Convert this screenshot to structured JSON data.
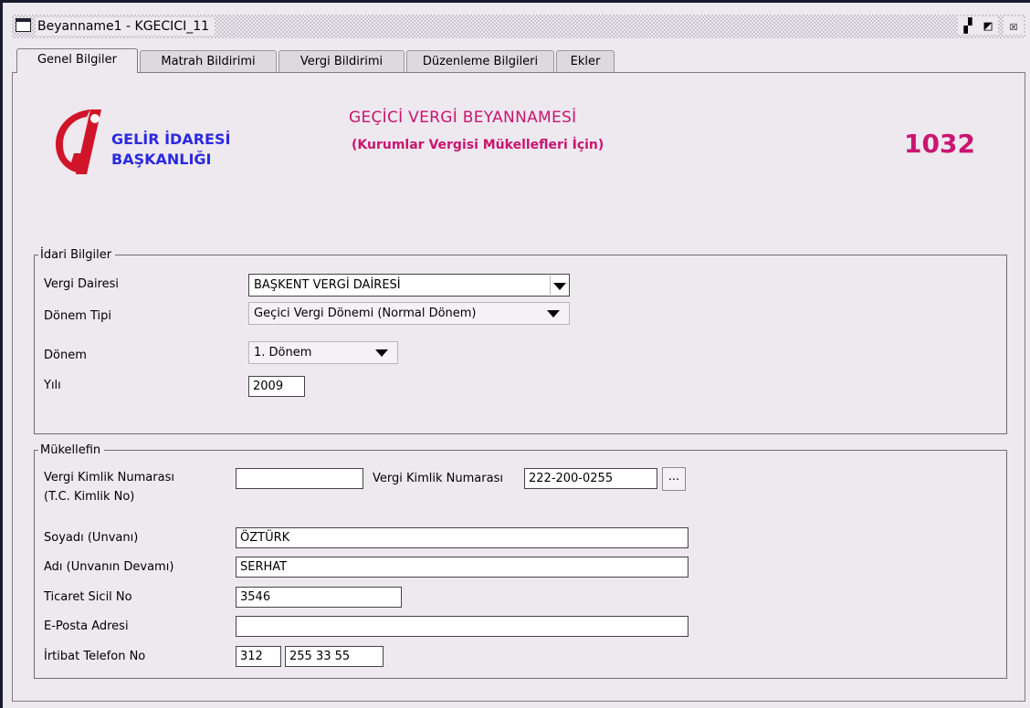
{
  "window": {
    "title": "Beyanname1 - KGECICI_11",
    "buttons": {
      "restore": "▞",
      "maximize": "◩",
      "close": "☒"
    }
  },
  "tabs": [
    {
      "label": "Genel Bilgiler",
      "active": true
    },
    {
      "label": "Matrah Bildirimi",
      "active": false
    },
    {
      "label": "Vergi Bildirimi",
      "active": false
    },
    {
      "label": "Düzenleme Bilgileri",
      "active": false
    },
    {
      "label": "Ekler",
      "active": false
    }
  ],
  "header": {
    "org_line1": "GELİR İDARESİ",
    "org_line2": "BAŞKANLIĞI",
    "form_title": "GEÇİCİ VERGİ BEYANNAMESİ",
    "form_subtitle": "(Kurumlar Vergisi Mükellefleri İçin)",
    "form_code": "1032",
    "colors": {
      "brand_blue": "#2a2ae0",
      "title_magenta": "#c8156f",
      "logo_red": "#d0152a"
    }
  },
  "idari": {
    "legend": "İdari Bilgiler",
    "vergi_dairesi_label": "Vergi Dairesi",
    "vergi_dairesi_value": "BAŞKENT VERGİ DAİRESİ",
    "donem_tipi_label": "Dönem Tipi",
    "donem_tipi_value": "Geçici Vergi Dönemi (Normal Dönem)",
    "donem_label": "Dönem",
    "donem_value": "1. Dönem",
    "yil_label": "Yılı",
    "yil_value": "2009"
  },
  "mukellef": {
    "legend": "Mükellefin",
    "vkn_tc_label_1": "Vergi Kimlik Numarası",
    "vkn_tc_label_2": "(T.C. Kimlik No)",
    "vkn_tc_value": "",
    "vkn_label": "Vergi Kimlik Numarası",
    "vkn_value": "222-200-0255",
    "lookup_button": "...",
    "soyadi_label": "Soyadı (Unvanı)",
    "soyadi_value": "ÖZTÜRK",
    "adi_label": "Adı (Unvanın Devamı)",
    "adi_value": "SERHAT",
    "ticaret_label": "Ticaret Sicil No",
    "ticaret_value": "3546",
    "eposta_label": "E-Posta Adresi",
    "eposta_value": "",
    "telefon_label": "İrtibat Telefon No",
    "telefon_alan_kodu": "312",
    "telefon_numara": "255 33 55"
  }
}
